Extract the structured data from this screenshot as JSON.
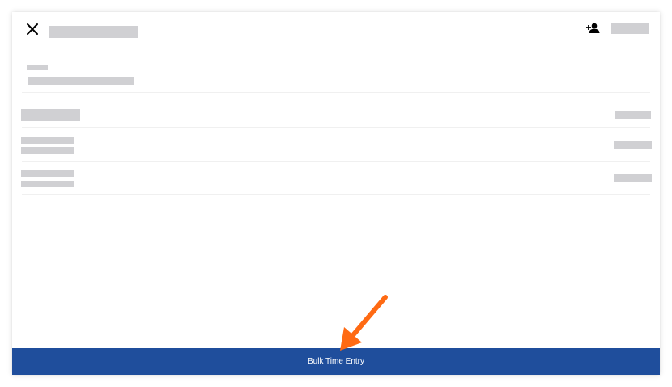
{
  "header": {
    "close_icon": "close-icon",
    "add_person_icon": "person-add-icon"
  },
  "footer": {
    "bulk_time_entry_label": "Bulk Time Entry"
  },
  "annotation": {
    "arrow_icon": "arrow-icon"
  },
  "colors": {
    "primary_bar": "#1f4e9c",
    "placeholder": "#d0d0d3",
    "arrow": "#ff6a13"
  }
}
